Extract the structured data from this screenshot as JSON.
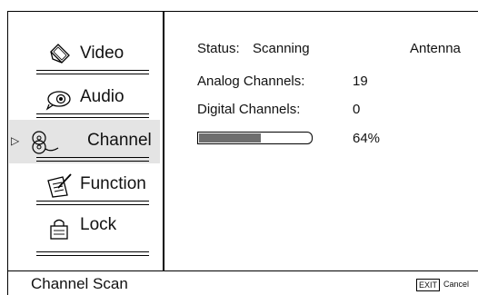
{
  "menu": {
    "items": [
      {
        "label": "Video",
        "icon": "video-tablet-icon",
        "selected": false
      },
      {
        "label": "Audio",
        "icon": "audio-speaker-icon",
        "selected": false
      },
      {
        "label": "Channel",
        "icon": "channel-reels-icon",
        "selected": true
      },
      {
        "label": "Function",
        "icon": "function-pen-icon",
        "selected": false
      },
      {
        "label": "Lock",
        "icon": "lock-hand-icon",
        "selected": false
      }
    ],
    "pointer": "▷"
  },
  "scan": {
    "status_label": "Status:",
    "status_value": "Scanning",
    "source": "Antenna",
    "analog_label": "Analog Channels:",
    "analog_value": "19",
    "digital_label": "Digital Channels:",
    "digital_value": "0",
    "progress_percent": 64,
    "progress_text": "64%",
    "progress_fill_fraction": 0.55
  },
  "footer": {
    "title": "Channel Scan",
    "exit_key": "EXIT",
    "exit_label": "Cancel"
  },
  "colors": {
    "selected_bg": "#e4e4e4",
    "progress_fill": "#6e6e6e",
    "text": "#111111"
  }
}
